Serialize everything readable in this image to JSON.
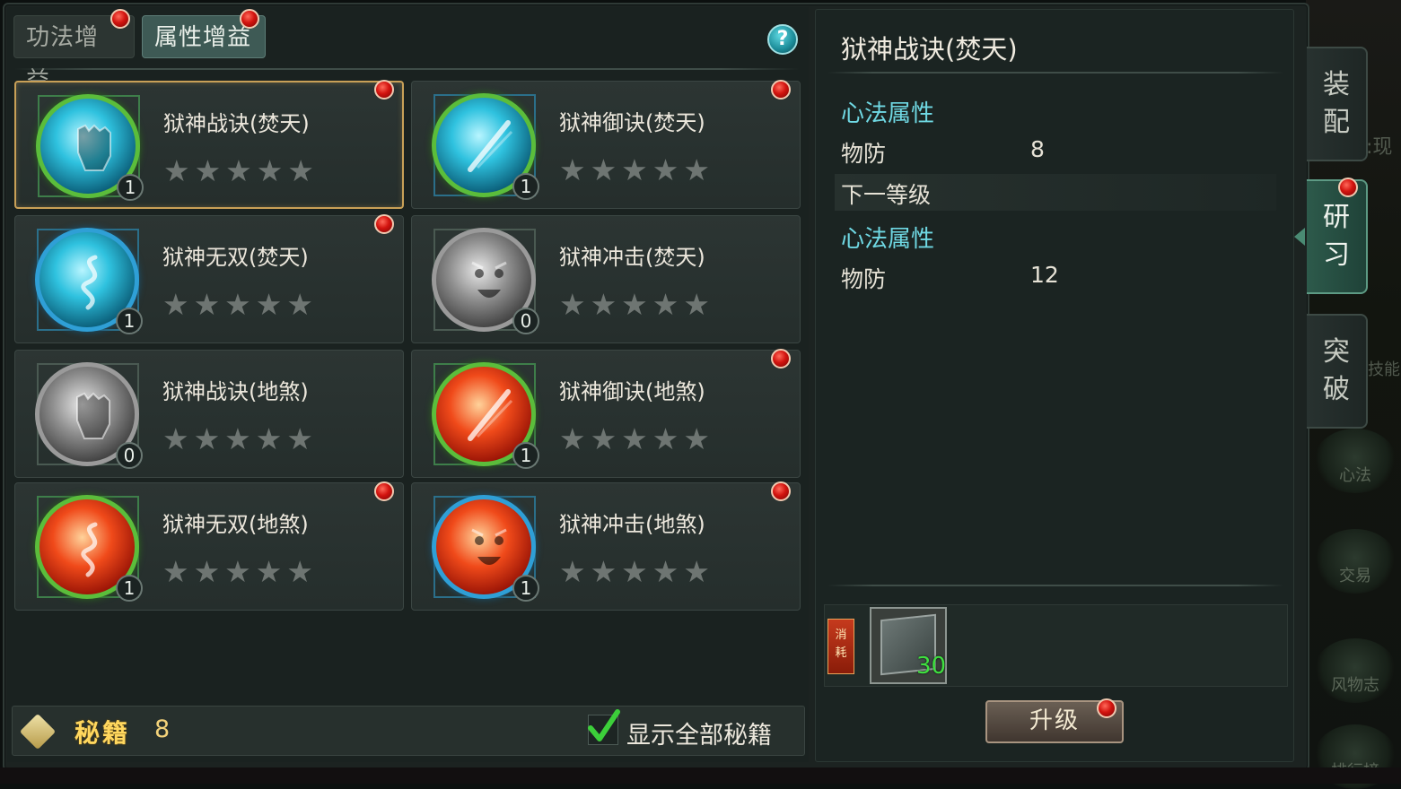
{
  "tabs": [
    {
      "label": "功法增益",
      "active": false
    },
    {
      "label": "属性增益",
      "active": true
    }
  ],
  "help": {
    "label": "?"
  },
  "skills": [
    {
      "name": "狱神战诀(焚天)",
      "level": "1",
      "stars": "★★★★★",
      "selected": true,
      "icon": "fist-icon"
    },
    {
      "name": "狱神御诀(焚天)",
      "level": "1",
      "stars": "★★★★★",
      "selected": false,
      "icon": "shield-slash-icon"
    },
    {
      "name": "狱神无双(焚天)",
      "level": "1",
      "stars": "★★★★★",
      "selected": false,
      "icon": "dragon-icon"
    },
    {
      "name": "狱神冲击(焚天)",
      "level": "0",
      "stars": "★★★★★",
      "selected": false,
      "icon": "beast-face-icon"
    },
    {
      "name": "狱神战诀(地煞)",
      "level": "0",
      "stars": "★★★★★",
      "selected": false,
      "icon": "fist-icon"
    },
    {
      "name": "狱神御诀(地煞)",
      "level": "1",
      "stars": "★★★★★",
      "selected": false,
      "icon": "shield-slash-icon"
    },
    {
      "name": "狱神无双(地煞)",
      "level": "1",
      "stars": "★★★★★",
      "selected": false,
      "icon": "dragon-icon"
    },
    {
      "name": "狱神冲击(地煞)",
      "level": "1",
      "stars": "★★★★★",
      "selected": false,
      "icon": "beast-face-icon"
    }
  ],
  "bottom": {
    "miji_label": "秘籍",
    "miji_count": "8",
    "show_all_label": "显示全部秘籍",
    "show_all_checked": true
  },
  "detail": {
    "title": "狱神战诀(焚天)",
    "current_section": "心法属性",
    "current_stat_name": "物防",
    "current_stat_value": "8",
    "next_level_label": "下一等级",
    "next_section": "心法属性",
    "next_stat_name": "物防",
    "next_stat_value": "12",
    "cost_tag": "消耗",
    "cost_item_qty": "30",
    "upgrade_label": "升级"
  },
  "side_tabs": [
    {
      "label": "装配",
      "active": false
    },
    {
      "label": "研习",
      "active": true
    },
    {
      "label": "突破",
      "active": false
    }
  ],
  "background_menu": [
    "心法",
    "交易",
    "风物志",
    "排行榜"
  ],
  "background_partial_text": [
    ":现",
    "技能"
  ],
  "colors": {
    "accent_cyan": "#6fd8e3",
    "gold": "#ffd75e",
    "qty_green": "#3fe040",
    "selected_border": "#c8a057",
    "notify_red": "#d3140f"
  }
}
